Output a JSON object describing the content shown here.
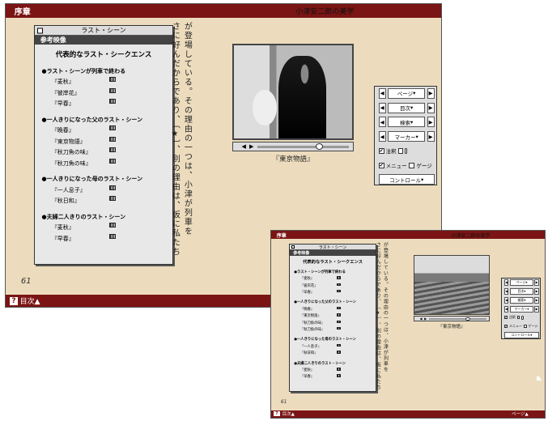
{
  "chapter": "序章",
  "book_title": "小津安二郎の美学",
  "window_title": "ラスト・シーン",
  "panel_header": "参考映像",
  "panel_heading": "代表的なラスト・シークエンス",
  "sections": [
    {
      "title": "●ラスト・シーンが列車で終わる",
      "items": [
        "『麦秋』",
        "『彼岸花』",
        "『早春』"
      ]
    },
    {
      "title": "●一人きりになった父のラスト・シーン",
      "items": [
        "『晩春』",
        "『東京物語』",
        "『秋刀魚の味』",
        "『秋刀魚の味』"
      ]
    },
    {
      "title": "●一人きりになった母のラスト・シーン",
      "items": [
        "『一人息子』",
        "『秋日和』"
      ]
    },
    {
      "title": "●夫婦二人きりのラスト・シーン",
      "items": [
        "『麦秋』",
        "『早春』"
      ]
    }
  ],
  "vertical_text": [
    "が登場している。その理由の一つは、小津が列車を",
    "さに好んだからであり、〔★〕、別の理由は、仮に私たち"
  ],
  "caption": "『東京物語』",
  "nav": {
    "page": "ページ",
    "toc": "目次",
    "search": "検索",
    "marker": "マーカー",
    "note": "注釈",
    "menu": "メニュー",
    "gauge": "ゲージ",
    "control": "コントロール"
  },
  "page_number": "61",
  "footer_help": "?",
  "footer_toc": "目次▲",
  "footer_page": "ページ▲"
}
